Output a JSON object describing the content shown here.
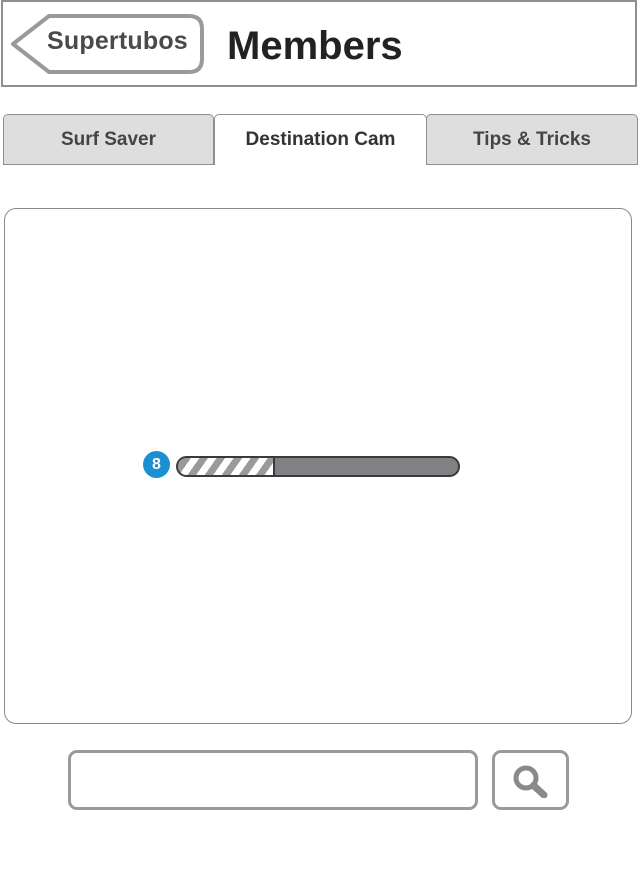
{
  "header": {
    "back_label": "Supertubos",
    "title": "Members"
  },
  "tabs": [
    {
      "label": "Surf Saver",
      "active": false
    },
    {
      "label": "Destination Cam",
      "active": true
    },
    {
      "label": "Tips & Tricks",
      "active": false
    }
  ],
  "main": {
    "step_badge": "8",
    "progress": 0.34
  },
  "search": {
    "placeholder": "",
    "value": ""
  },
  "colors": {
    "badge": "#1b8fd0",
    "border": "#8f8f8f",
    "inactive_tab": "#dedede"
  }
}
